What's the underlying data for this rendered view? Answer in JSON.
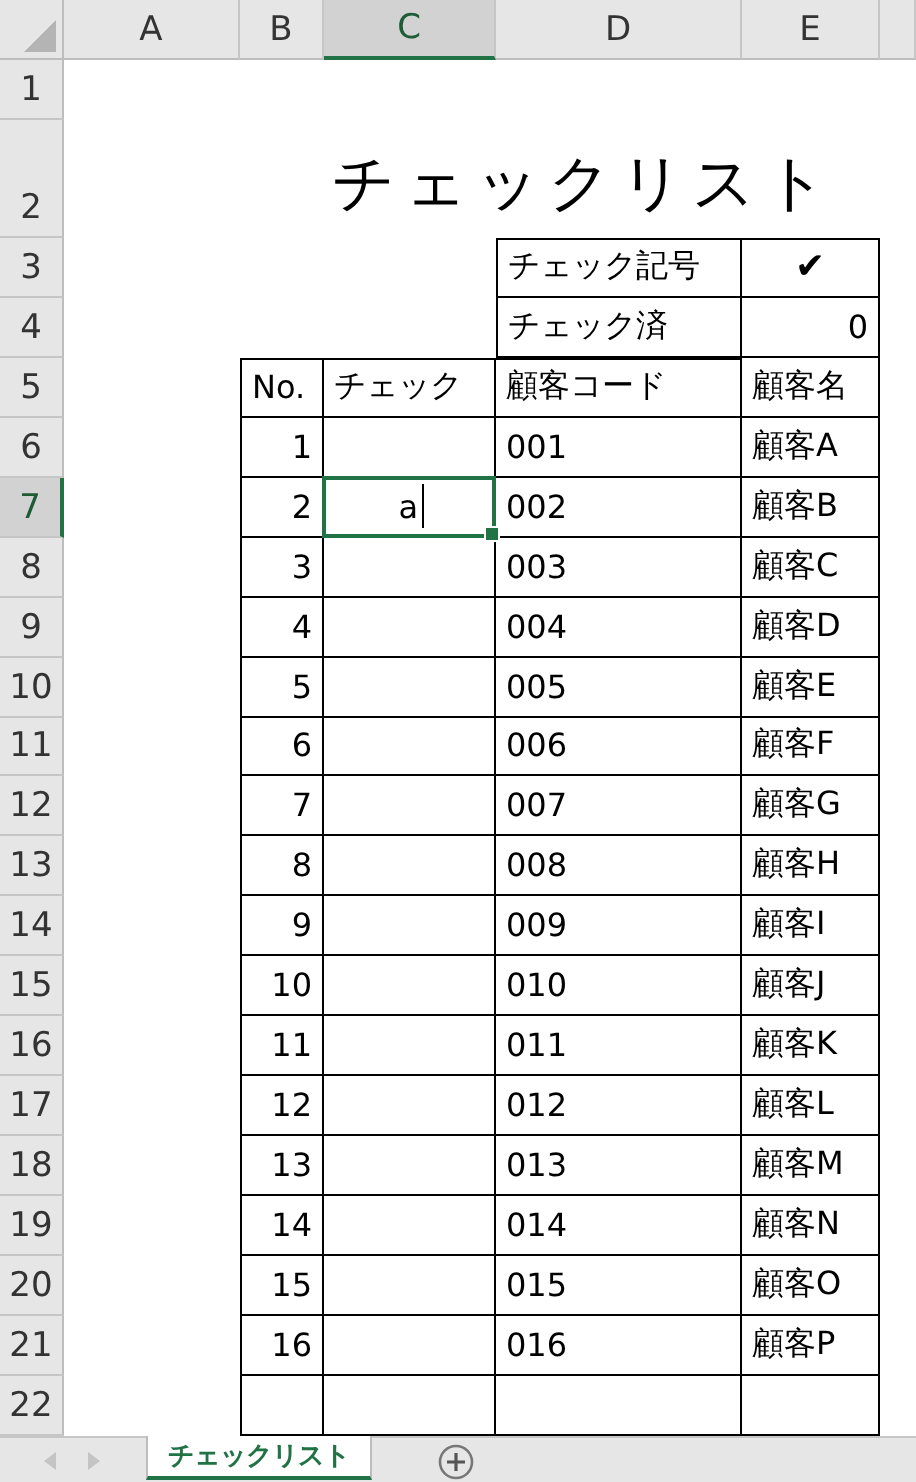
{
  "columns": [
    {
      "label": "A",
      "selected": false
    },
    {
      "label": "B",
      "selected": false
    },
    {
      "label": "C",
      "selected": true
    },
    {
      "label": "D",
      "selected": false
    },
    {
      "label": "E",
      "selected": false
    }
  ],
  "row_numbers": [
    {
      "label": "1",
      "selected": false
    },
    {
      "label": "2",
      "selected": false
    },
    {
      "label": "3",
      "selected": false
    },
    {
      "label": "4",
      "selected": false
    },
    {
      "label": "5",
      "selected": false
    },
    {
      "label": "6",
      "selected": false
    },
    {
      "label": "7",
      "selected": true
    },
    {
      "label": "8",
      "selected": false
    },
    {
      "label": "9",
      "selected": false
    },
    {
      "label": "10",
      "selected": false
    },
    {
      "label": "11",
      "selected": false
    },
    {
      "label": "12",
      "selected": false
    },
    {
      "label": "13",
      "selected": false
    },
    {
      "label": "14",
      "selected": false
    },
    {
      "label": "15",
      "selected": false
    },
    {
      "label": "16",
      "selected": false
    },
    {
      "label": "17",
      "selected": false
    },
    {
      "label": "18",
      "selected": false
    },
    {
      "label": "19",
      "selected": false
    },
    {
      "label": "20",
      "selected": false
    },
    {
      "label": "21",
      "selected": false
    },
    {
      "label": "22",
      "selected": false
    }
  ],
  "title": "チェックリスト",
  "settings": [
    {
      "label": "チェック記号",
      "value": "✔",
      "kind": "symbol"
    },
    {
      "label": "チェック済",
      "value": "0",
      "kind": "number"
    }
  ],
  "table": {
    "columns": [
      "No.",
      "チェック",
      "顧客コード",
      "顧客名"
    ],
    "rows": [
      {
        "no": "1",
        "check": "",
        "code": "001",
        "name": "顧客A",
        "selected": false
      },
      {
        "no": "2",
        "check": "a",
        "code": "002",
        "name": "顧客B",
        "selected": true
      },
      {
        "no": "3",
        "check": "",
        "code": "003",
        "name": "顧客C",
        "selected": false
      },
      {
        "no": "4",
        "check": "",
        "code": "004",
        "name": "顧客D",
        "selected": false
      },
      {
        "no": "5",
        "check": "",
        "code": "005",
        "name": "顧客E",
        "selected": false
      },
      {
        "no": "6",
        "check": "",
        "code": "006",
        "name": "顧客F",
        "selected": false
      },
      {
        "no": "7",
        "check": "",
        "code": "007",
        "name": "顧客G",
        "selected": false
      },
      {
        "no": "8",
        "check": "",
        "code": "008",
        "name": "顧客H",
        "selected": false
      },
      {
        "no": "9",
        "check": "",
        "code": "009",
        "name": "顧客I",
        "selected": false
      },
      {
        "no": "10",
        "check": "",
        "code": "010",
        "name": "顧客J",
        "selected": false
      },
      {
        "no": "11",
        "check": "",
        "code": "011",
        "name": "顧客K",
        "selected": false
      },
      {
        "no": "12",
        "check": "",
        "code": "012",
        "name": "顧客L",
        "selected": false
      },
      {
        "no": "13",
        "check": "",
        "code": "013",
        "name": "顧客M",
        "selected": false
      },
      {
        "no": "14",
        "check": "",
        "code": "014",
        "name": "顧客N",
        "selected": false
      },
      {
        "no": "15",
        "check": "",
        "code": "015",
        "name": "顧客O",
        "selected": false
      },
      {
        "no": "16",
        "check": "",
        "code": "016",
        "name": "顧客P",
        "selected": false
      }
    ]
  },
  "sheet_tabs": [
    {
      "label": "チェックリスト",
      "selected": true
    }
  ]
}
